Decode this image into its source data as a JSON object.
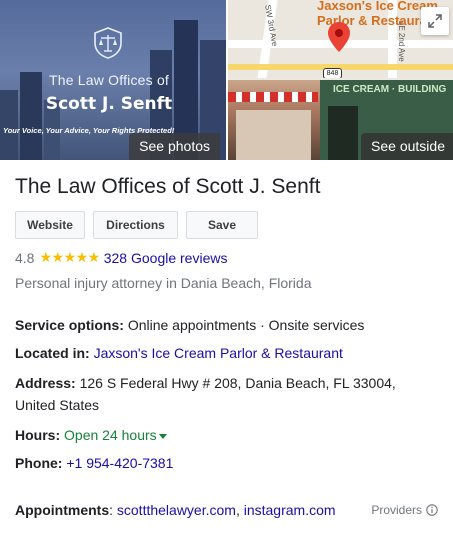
{
  "photos": {
    "firm_line1": "The Law Offices of",
    "firm_line2": "Scott J. Senft",
    "tagline": "Your Voice, Your Advice, Your Rights Protected!",
    "see_photos": "See photos"
  },
  "map": {
    "street1": "SW 3rd Ave",
    "street2": "SE 2nd Ave",
    "place_line1": "Jaxson's Ice Cream",
    "place_line2": "Parlor & Restaurant",
    "route_shield": "848"
  },
  "street_view": {
    "sign": "ICE CREAM · BUILDING",
    "see_outside": "See outside"
  },
  "business": {
    "name": "The Law Offices of Scott J. Senft",
    "buttons": [
      "Website",
      "Directions",
      "Save"
    ],
    "rating": "4.8",
    "stars": "★★★★★",
    "reviews": "328 Google reviews",
    "category": "Personal injury attorney in Dania Beach, Florida"
  },
  "details": {
    "service_label": "Service options:",
    "service_value": "Online appointments · Onsite services",
    "located_label": "Located in:",
    "located_value": "Jaxson's Ice Cream Parlor & Restaurant",
    "address_label": "Address:",
    "address_line1": "126 S Federal Hwy # 208, Dania Beach, FL 33004,",
    "address_line2": "United States",
    "hours_label": "Hours:",
    "hours_value": "Open 24 hours",
    "phone_label": "Phone:",
    "phone_value": "+1 954-420-7381",
    "appointments_label": "Appointments",
    "appointments_sep": ":",
    "appointments_link1": "scottthelawyer.com",
    "appointments_comma": ",",
    "appointments_link2": "instagram.com",
    "providers": "Providers"
  },
  "colors": {
    "link": "#1a0dab",
    "open_green": "#188038",
    "star": "#fbbc04",
    "map_pin": "#ea4335"
  }
}
